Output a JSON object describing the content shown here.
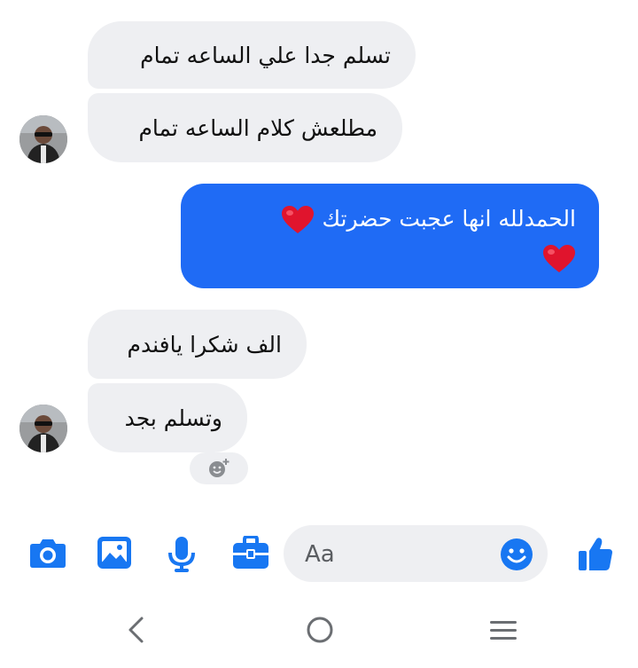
{
  "messages": [
    {
      "text": "تسلم جدا علي الساعه تمام"
    },
    {
      "text": "مطلعش كلام الساعه تمام"
    },
    {
      "text": "الحمدلله انها عجبت حضرتك"
    },
    {
      "text": "الف شكرا يافندم"
    },
    {
      "text": "وتسلم بجد"
    }
  ],
  "composer": {
    "placeholder": "Aa"
  },
  "colors": {
    "accent": "#1f6bf5",
    "incoming_bubble": "#eeeff2",
    "icon_blue": "#1877f2",
    "heart_red": "#e0142d"
  },
  "icons": [
    "camera-icon",
    "image-icon",
    "microphone-icon",
    "briefcase-icon",
    "smiley-icon",
    "thumbs-up-icon",
    "add-reaction-icon",
    "back-icon",
    "home-icon",
    "menu-icon"
  ]
}
